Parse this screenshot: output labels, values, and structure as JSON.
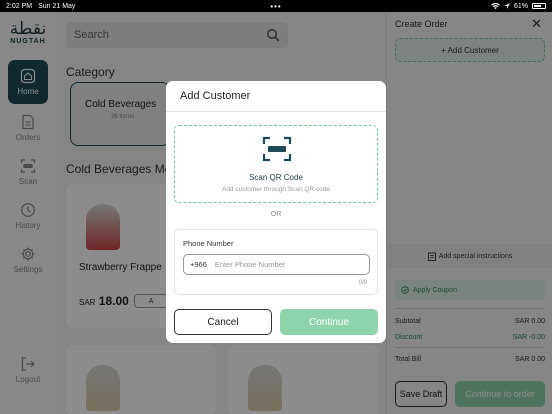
{
  "status_bar": {
    "time": "2:02 PM",
    "date": "Sun 21 May",
    "dots": "•••",
    "wifi_icon": "wifi-icon",
    "battery_text": "61%"
  },
  "sidebar": {
    "logo_ar": "نقطة",
    "logo_en": "NUGTAH",
    "items": [
      {
        "label": "Home",
        "icon": "home-icon",
        "active": true
      },
      {
        "label": "Orders",
        "icon": "orders-icon"
      },
      {
        "label": "Scan",
        "icon": "scan-icon"
      },
      {
        "label": "History",
        "icon": "history-icon"
      },
      {
        "label": "Settings",
        "icon": "gear-icon"
      },
      {
        "label": "Logout",
        "icon": "logout-icon"
      }
    ]
  },
  "main": {
    "search_placeholder": "Search",
    "category_heading": "Category",
    "category_card": {
      "name": "Cold Beverages",
      "count": "26 Items"
    },
    "menu_heading": "Cold Beverages Me",
    "products": [
      {
        "name": "Strawberry Frappe",
        "currency": "SAR",
        "price": "18.00",
        "add_label": "A"
      }
    ]
  },
  "order_panel": {
    "title": "Create Order",
    "close": "✕",
    "add_customer": "+ Add Customer",
    "special_instructions": "Add special instructions",
    "coupon": "Apply Coupon",
    "subtotal_label": "Subtotal",
    "subtotal_value": "SAR 0.00",
    "discount_label": "Discount",
    "discount_value": "SAR -0.00",
    "total_label": "Total Bill",
    "total_value": "SAR 0.00",
    "save_draft": "Save Draft",
    "continue_order": "Continue to order"
  },
  "modal": {
    "title": "Add Customer",
    "scan_title": "Scan QR Code",
    "scan_subtitle": "Add customer through Scan QR code",
    "or": "OR",
    "phone_label": "Phone Number",
    "country_code": "+966",
    "phone_placeholder": "Enter Phone Number",
    "phone_counter": "0/9",
    "cancel": "Cancel",
    "continue": "Continue"
  },
  "colors": {
    "brand_dark": "#1d4b55",
    "accent_green": "#8fd3ad",
    "dashed_green": "#7bc79e"
  }
}
